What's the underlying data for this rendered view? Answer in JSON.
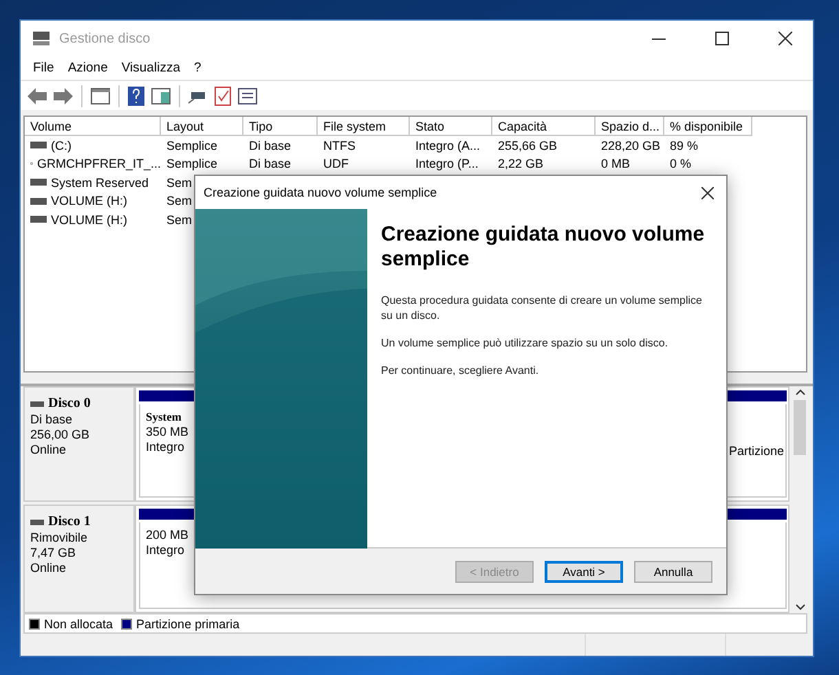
{
  "window": {
    "title": "Gestione disco"
  },
  "menu": [
    "File",
    "Azione",
    "Visualizza",
    "?"
  ],
  "table": {
    "columns": [
      "Volume",
      "Layout",
      "Tipo",
      "File system",
      "Stato",
      "Capacità",
      "Spazio d...",
      "% disponibile"
    ],
    "rows": [
      {
        "kind": "fixed",
        "cells": [
          "(C:)",
          "Semplice",
          "Di base",
          "NTFS",
          "Integro (A...",
          "255,66 GB",
          "228,20 GB",
          "89 %"
        ]
      },
      {
        "kind": "optical",
        "cells": [
          "GRMCHPFRER_IT_...",
          "Semplice",
          "Di base",
          "UDF",
          "Integro (P...",
          "2,22 GB",
          "0 MB",
          "0 %"
        ]
      },
      {
        "kind": "fixed",
        "cells": [
          "System Reserved",
          "Sem"
        ]
      },
      {
        "kind": "fixed",
        "cells": [
          "VOLUME (H:)",
          "Sem"
        ]
      },
      {
        "kind": "fixed",
        "cells": [
          "VOLUME (H:)",
          "Sem"
        ]
      }
    ]
  },
  "disks": [
    {
      "name": "Disco 0",
      "lines": [
        "Di base",
        "256,00 GB",
        "Online"
      ],
      "partitions": [
        {
          "lines": [
            "System",
            "350 MB",
            "Integro"
          ]
        },
        {
          "lines": [
            "Partizione"
          ]
        }
      ]
    },
    {
      "name": "Disco 1",
      "lines": [
        "Rimovibile",
        "7,47 GB",
        "Online"
      ],
      "partitions": [
        {
          "lines": [
            "200 MB",
            "Integro"
          ]
        }
      ]
    }
  ],
  "legend": [
    {
      "label": "Non allocata",
      "color": "#000000"
    },
    {
      "label": "Partizione primaria",
      "color": "#000080"
    }
  ],
  "dialog": {
    "title": "Creazione guidata nuovo volume semplice",
    "heading": "Creazione guidata nuovo volume semplice",
    "paragraphs": [
      "Questa procedura guidata consente di creare un volume semplice su un disco.",
      "Un volume semplice può utilizzare spazio su un solo disco.",
      "Per continuare, scegliere Avanti."
    ],
    "buttons": [
      {
        "label": "< Indietro",
        "disabled": true,
        "default": false
      },
      {
        "label": "Avanti >",
        "disabled": false,
        "default": true
      },
      {
        "label": "Annulla",
        "disabled": false,
        "default": false
      }
    ]
  }
}
